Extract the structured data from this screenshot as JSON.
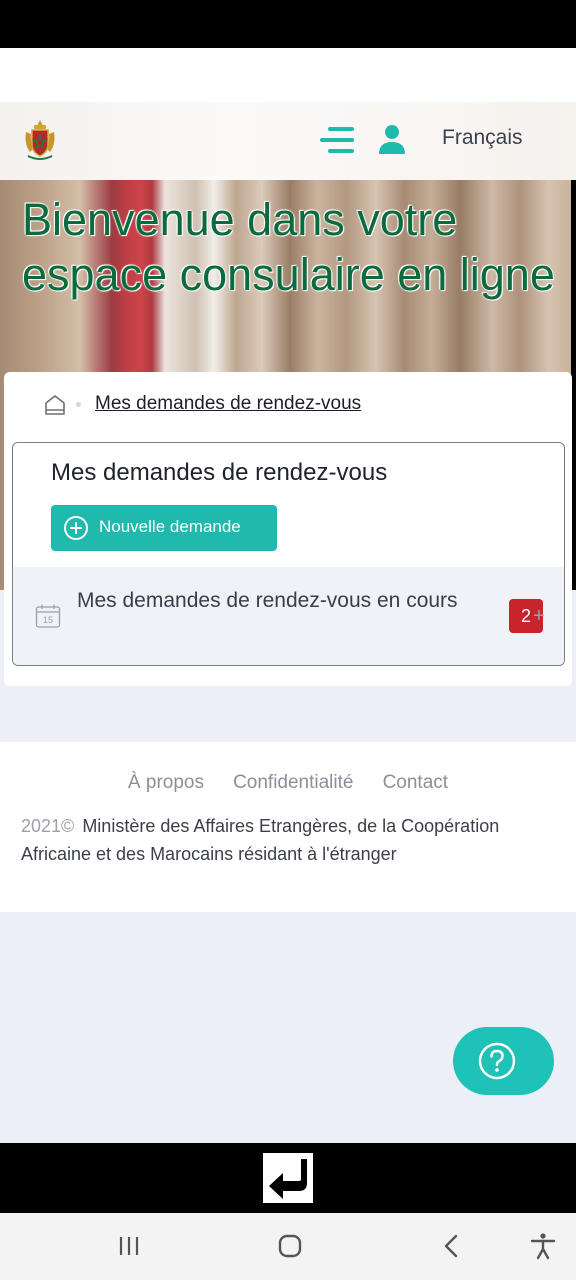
{
  "header": {
    "language": "Français",
    "icons": {
      "emblem": "morocco-emblem-icon",
      "menu": "menu-icon",
      "user": "user-icon"
    }
  },
  "hero": {
    "title": "Bienvenue dans votre espace consulaire en ligne"
  },
  "breadcrumb": {
    "current": "Mes demandes de rendez-vous"
  },
  "panel": {
    "title": "Mes demandes de rendez-vous",
    "new_button": "Nouvelle demande",
    "row_label": "Mes demandes de rendez-vous en cours",
    "badge_count": "2",
    "calendar_day": "15"
  },
  "footer": {
    "links": [
      "À propos",
      "Confidentialité",
      "Contact"
    ],
    "year": "2021©",
    "copyright": "Ministère des Affaires Etrangères, de la Coopération Africaine et des Marocains résidant à l'étranger"
  },
  "help": {
    "icon": "question-icon"
  },
  "colors": {
    "accent": "#20b9ad",
    "brand_green": "#0c6b3e",
    "badge": "#c9242c"
  }
}
